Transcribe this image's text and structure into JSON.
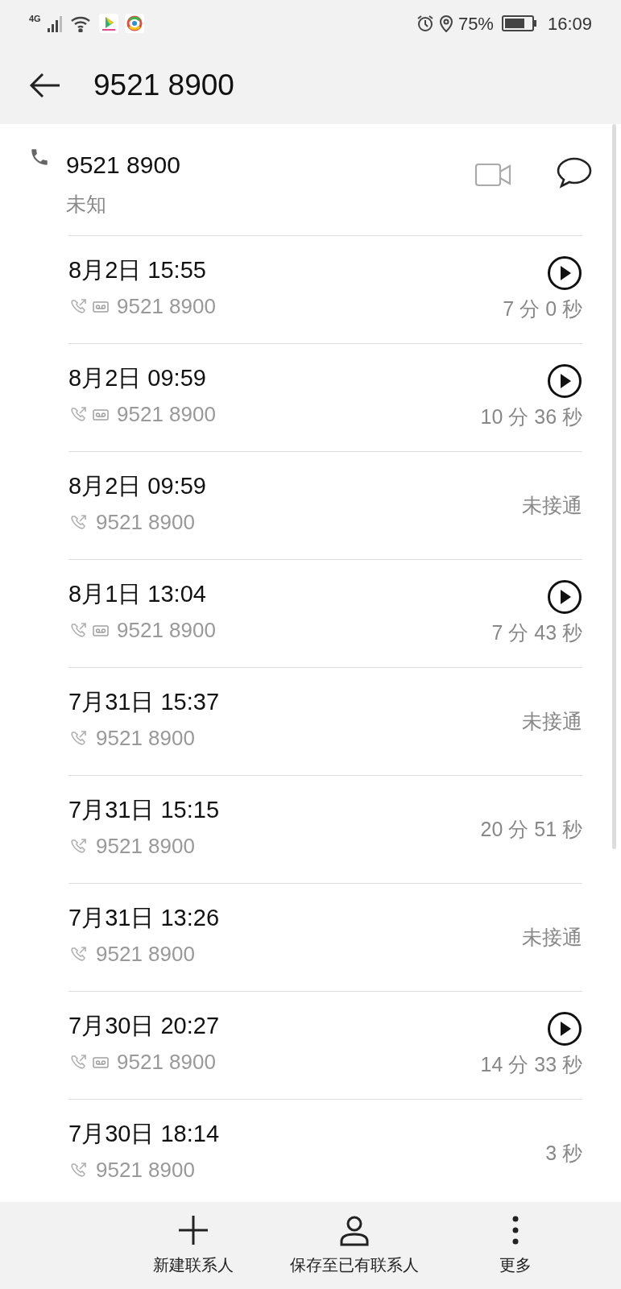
{
  "status_bar": {
    "network": "4G",
    "battery": "75%",
    "time": "16:09"
  },
  "header": {
    "title": "9521 8900"
  },
  "contact": {
    "number": "9521 8900",
    "label": "未知"
  },
  "calls": [
    {
      "date": "8月2日 15:55",
      "number": "9521 8900",
      "voicemail": true,
      "duration": "7 分 0 秒"
    },
    {
      "date": "8月2日 09:59",
      "number": "9521 8900",
      "voicemail": true,
      "duration": "10 分 36 秒"
    },
    {
      "date": "8月2日 09:59",
      "number": "9521 8900",
      "voicemail": false,
      "duration": "未接通"
    },
    {
      "date": "8月1日 13:04",
      "number": "9521 8900",
      "voicemail": true,
      "duration": "7 分 43 秒"
    },
    {
      "date": "7月31日 15:37",
      "number": "9521 8900",
      "voicemail": false,
      "duration": "未接通"
    },
    {
      "date": "7月31日 15:15",
      "number": "9521 8900",
      "voicemail": false,
      "duration": "20 分 51 秒"
    },
    {
      "date": "7月31日 13:26",
      "number": "9521 8900",
      "voicemail": false,
      "duration": "未接通"
    },
    {
      "date": "7月30日 20:27",
      "number": "9521 8900",
      "voicemail": true,
      "duration": "14 分 33 秒"
    },
    {
      "date": "7月30日 18:14",
      "number": "9521 8900",
      "voicemail": false,
      "duration": "3 秒"
    }
  ],
  "bottom_actions": [
    {
      "kind": "add",
      "label": "新建联系人"
    },
    {
      "kind": "person",
      "label": "保存至已有联系人"
    },
    {
      "kind": "more",
      "label": "更多"
    }
  ]
}
